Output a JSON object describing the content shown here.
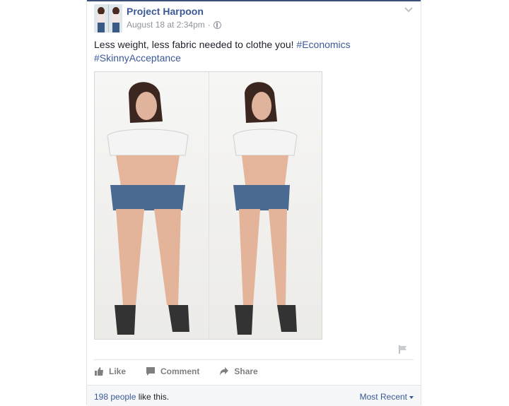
{
  "post": {
    "author": "Project Harpoon",
    "timestamp": "August 18 at 2:34pm",
    "separator": "·",
    "privacy_icon": "globe-icon",
    "text": "Less weight, less fabric needed to clothe you!",
    "hashtags": [
      "#Economics",
      "#SkinnyAcceptance"
    ]
  },
  "actions": {
    "like": "Like",
    "comment": "Comment",
    "share": "Share"
  },
  "footer": {
    "like_count": "198 people",
    "like_suffix": " like this.",
    "sort_label": "Most Recent"
  },
  "colors": {
    "brand_blue": "#3b5998",
    "meta_gray": "#90949c",
    "text": "#1d2129",
    "footer_bg": "#f6f7f9"
  }
}
